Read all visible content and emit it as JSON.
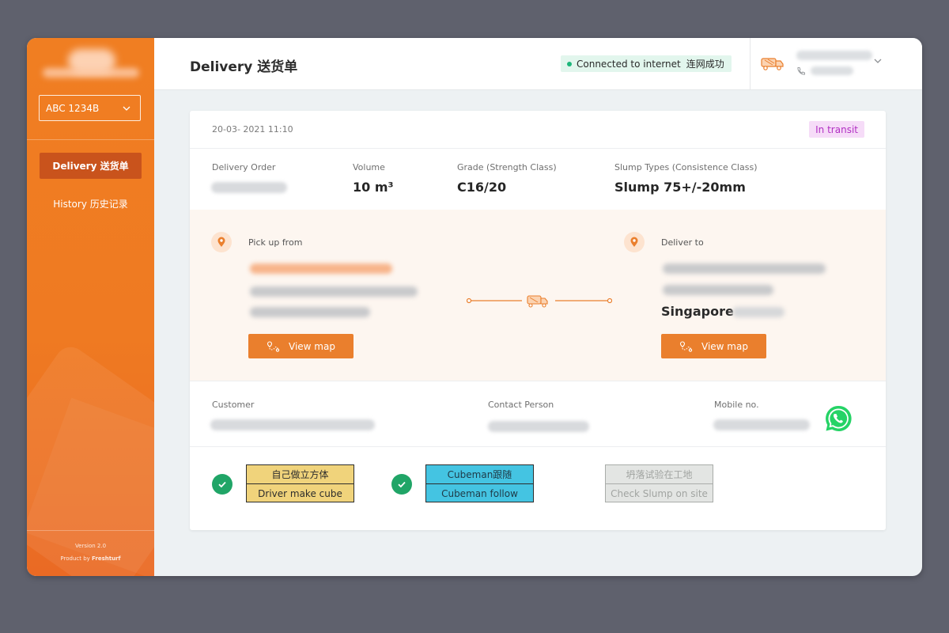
{
  "header": {
    "title": "Delivery 送货单",
    "connection_status": "Connected to internet",
    "connection_status_cn": "连网成功",
    "icons": [
      "truck-icon",
      "phone-icon",
      "chevron-down-icon"
    ]
  },
  "sidebar": {
    "vehicle_plate": "ABC 1234B",
    "nav": [
      {
        "label": "Delivery 送货单",
        "active": true
      },
      {
        "label": "History 历史记录",
        "active": false
      }
    ],
    "version": "Version 2.0",
    "product_prefix": "Product by",
    "product_brand": "Freshturf"
  },
  "delivery": {
    "datetime": "20-03- 2021 11:10",
    "status": "In transit",
    "fields": {
      "delivery_order_label": "Delivery Order",
      "volume_label": "Volume",
      "volume_value": "10 m³",
      "grade_label": "Grade (Strength Class)",
      "grade_value": "C16/20",
      "slump_label": "Slump Types (Consistence Class)",
      "slump_value": "Slump 75+/-20mm"
    },
    "pickup": {
      "label": "Pick up from",
      "button": "View map"
    },
    "dropoff": {
      "label": "Deliver to",
      "city": "Singapore",
      "button": "View map"
    },
    "contacts": {
      "customer_label": "Customer",
      "contact_person_label": "Contact Person",
      "mobile_label": "Mobile no."
    },
    "tasks": [
      {
        "cn": "自己做立方体",
        "en": "Driver make cube",
        "checked": true
      },
      {
        "cn": "Cubeman跟随",
        "en": "Cubeman follow",
        "checked": true
      },
      {
        "cn": "坍落试验在工地",
        "en": "Check Slump on site",
        "checked": false
      }
    ]
  },
  "colors": {
    "accent": "#ea7f2d",
    "sidebar": "#ef7a22",
    "status_badge_bg": "#f6dcf8",
    "status_badge_text": "#b12fc3",
    "connected": "#1cb67a",
    "check": "#20a567",
    "whatsapp": "#25d366"
  }
}
